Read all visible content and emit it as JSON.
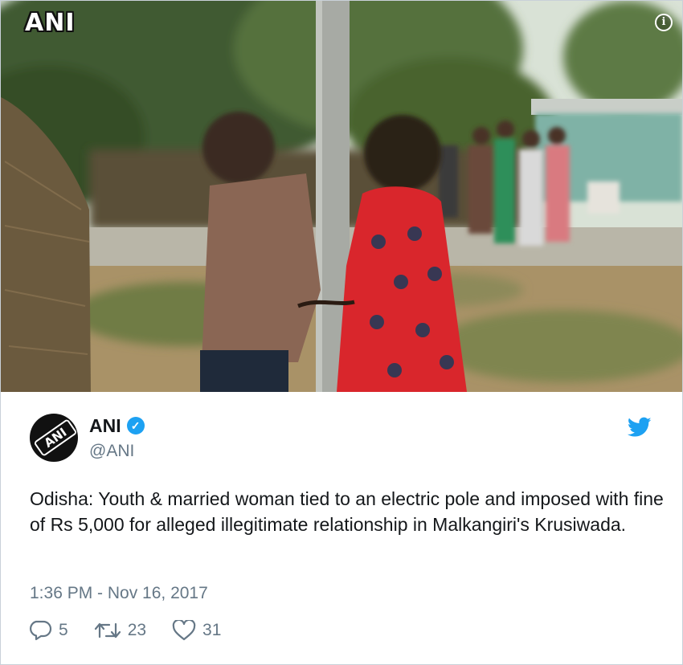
{
  "media": {
    "watermark": "ANI",
    "info_icon": "info-icon"
  },
  "tweet": {
    "avatar_text": "ANI",
    "display_name": "ANI",
    "handle": "@ANI",
    "verified": true,
    "text": "Odisha: Youth & married woman tied to an electric pole and imposed with fine of Rs 5,000 for alleged illegitimate relationship in Malkangiri's Krusiwada.",
    "timestamp": "1:36 PM - Nov 16, 2017",
    "replies": "5",
    "retweets": "23",
    "likes": "31"
  },
  "colors": {
    "twitter_blue": "#1da1f2",
    "secondary_text": "#657786",
    "primary_text": "#14171a"
  },
  "icons": [
    "info-icon",
    "verified-badge-icon",
    "twitter-bird-icon",
    "reply-icon",
    "retweet-icon",
    "like-icon"
  ]
}
